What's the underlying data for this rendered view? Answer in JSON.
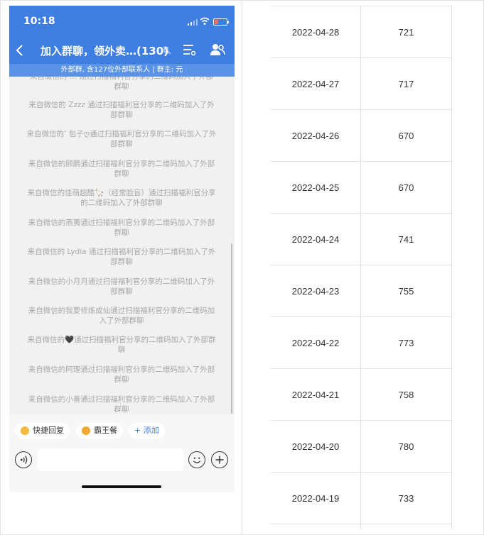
{
  "phone": {
    "time": "10:18",
    "title": "加入群聊，领外卖…(130)",
    "subtitle": "外部群, 含127位外部联系人 | 群主: 元",
    "messages": [
      "来自微信的 ... 通过扫描福利官分享的二维码加入了外部群聊",
      "来自微信的 Zzzz 通过扫描福利官分享的二维码加入了外部群聊",
      "来自微信的’ 包子ღ通过扫描福利官分享的二维码加入了外部群聊",
      "来自微信的顾鹏通过扫描福利官分享的二维码加入了外部群聊",
      "来自微信的佳萌超酷🦙（经常脸盲）通过扫描福利官分享的二维码加入了外部群聊",
      "来自微信的燕荑通过扫描福利官分享的二维码加入了外部群聊",
      "来自微信的 Lydia 通过扫描福利官分享的二维码加入了外部群聊",
      "来自微信的小月月通过扫描福利官分享的二维码加入了外部群聊",
      "来自微信的我要修炼成仙通过扫描福利官分享的二维码加入了外部群聊",
      "来自微信的🖤通过扫描福利官分享的二维码加入了外部群聊",
      "来自微信的阿理通过扫描福利官分享的二维码加入了外部群聊",
      "来自微信的小善通过扫描福利官分享的二维码加入了外部群聊"
    ],
    "quick_actions": {
      "quick_reply": "快捷回复",
      "bawang": "霸王餐",
      "add": "+ 添加"
    },
    "colors": {
      "header": "#3d7ee0",
      "subbar": "#5a93e6",
      "accent": "#3d7ee0"
    },
    "icons": [
      "back-icon",
      "mute-icon",
      "menu-icon",
      "members-icon",
      "voice-icon",
      "emoji-icon",
      "plus-icon"
    ]
  },
  "table": {
    "rows": [
      {
        "date": "2022-04-28",
        "value": "721"
      },
      {
        "date": "2022-04-27",
        "value": "717"
      },
      {
        "date": "2022-04-26",
        "value": "670"
      },
      {
        "date": "2022-04-25",
        "value": "670"
      },
      {
        "date": "2022-04-24",
        "value": "741"
      },
      {
        "date": "2022-04-23",
        "value": "755"
      },
      {
        "date": "2022-04-22",
        "value": "773"
      },
      {
        "date": "2022-04-21",
        "value": "758"
      },
      {
        "date": "2022-04-20",
        "value": "780"
      },
      {
        "date": "2022-04-19",
        "value": "733"
      }
    ]
  }
}
